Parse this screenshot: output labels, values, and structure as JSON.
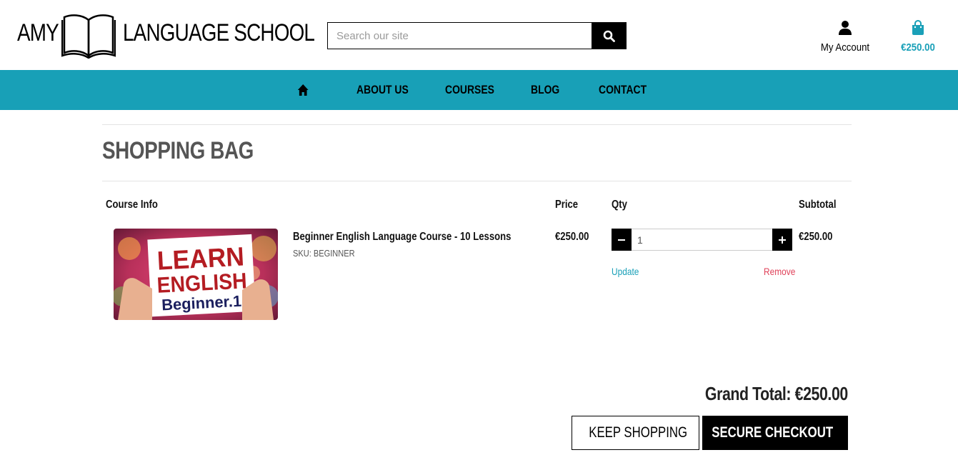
{
  "header": {
    "logo": {
      "left_text": "AMY",
      "right_text": "LANGUAGE SCHOOL"
    },
    "search": {
      "placeholder": "Search our site"
    },
    "account_label": "My Account",
    "bag_total": "€250.00"
  },
  "nav": {
    "items": [
      "ABOUT US",
      "COURSES",
      "BLOG",
      "CONTACT"
    ]
  },
  "page": {
    "title": "SHOPPING BAG"
  },
  "table": {
    "headers": {
      "info": "Course Info",
      "price": "Price",
      "qty": "Qty",
      "subtotal": "Subtotal"
    },
    "rows": [
      {
        "name": "Beginner English Language Course - 10 Lessons",
        "sku": "SKU: BEGINNER",
        "price": "€250.00",
        "qty": "1",
        "subtotal": "€250.00",
        "update": "Update",
        "remove": "Remove",
        "image": {
          "line1": "LEARN",
          "line2": "ENGLISH",
          "line3": "Beginner.1"
        }
      }
    ]
  },
  "totals": {
    "grand_total": "Grand Total: €250.00"
  },
  "actions": {
    "keep_shopping": "KEEP SHOPPING",
    "secure_checkout": "SECURE CHECKOUT"
  },
  "colors": {
    "brand": "#18a0b7",
    "remove": "#e0425a"
  }
}
